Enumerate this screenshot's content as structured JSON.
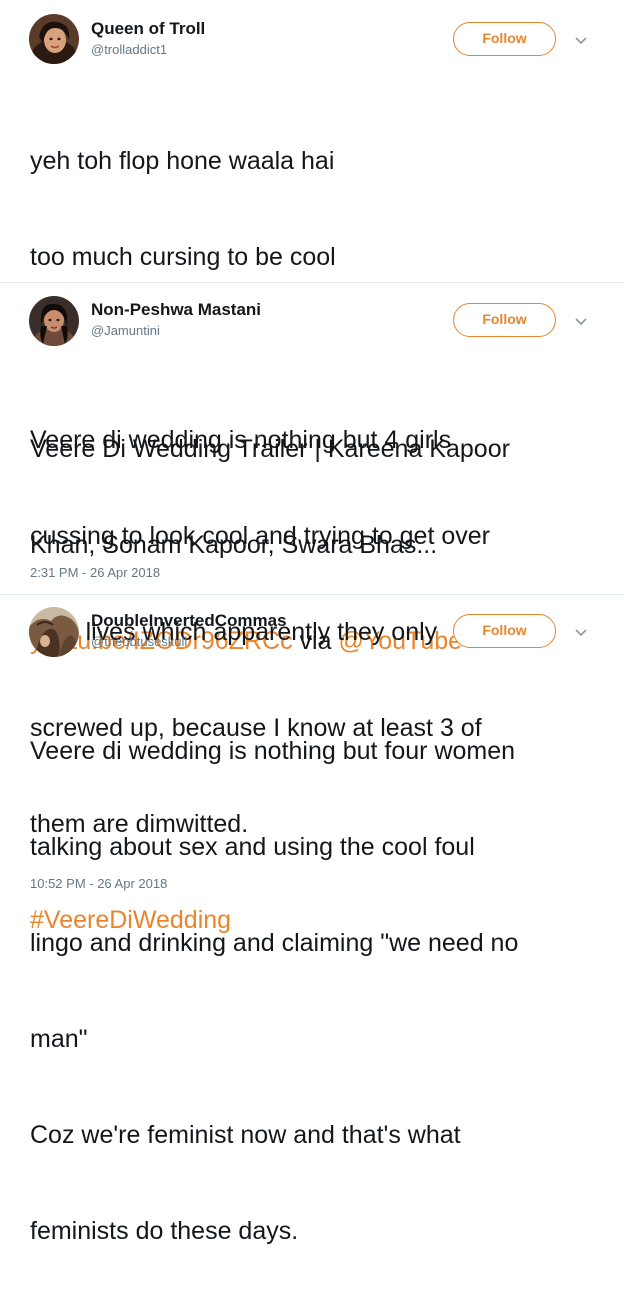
{
  "tweets": [
    {
      "name": "Queen of Troll",
      "handle": "@trolladdict1",
      "follow_label": "Follow",
      "line1": "yeh toh flop hone waala hai",
      "line2": "too much cursing to be cool",
      "line3": "Veere Di Wedding Trailer | Kareena Kapoor",
      "line4": "Khan, Sonam Kapoor, Swara Bhas...",
      "link_url": "youtu.be/IZODr96ZRCc",
      "via_text": " via ",
      "link_mention": "@YouTube"
    },
    {
      "name": "Non-Peshwa Mastani",
      "handle": "@Jamuntini",
      "follow_label": "Follow",
      "line1": "Veere di wedding is nothing but 4 girls",
      "line2": "cussing to look cool and trying to get over",
      "line3": "their lives which apparently they only",
      "line4": "screwed up, because I know at least 3 of",
      "line5": "them are dimwitted.",
      "hashtag": "#VeereDiWedding",
      "timestamp": "2:31 PM - 26 Apr 2018"
    },
    {
      "name": "DoubleInvertedCommas",
      "handle": "@theobtuseskull",
      "follow_label": "Follow",
      "line1": "Veere di wedding is nothing but four women",
      "line2": "talking about sex and using the cool foul",
      "line3": "lingo and drinking and claiming \"we need no",
      "line4": "man\"",
      "line5": "Coz we're feminist now and that's what",
      "line6": "feminists do these days.",
      "timestamp": "10:52 PM - 26 Apr 2018"
    }
  ],
  "colors": {
    "accent": "#e8852d",
    "text": "#14171a",
    "muted": "#657786"
  },
  "icons": {
    "more": "chevron-down-icon",
    "avatar": "avatar"
  }
}
